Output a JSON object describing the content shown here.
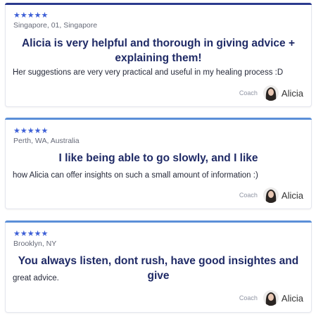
{
  "colors": {
    "accent_dark": "#2b3a8e",
    "accent_light": "#5b8fd8",
    "star": "#3d5fd6",
    "headline": "#1f2a66"
  },
  "reviews": [
    {
      "stars": "★★★★★",
      "location": "Singapore, 01, Singapore",
      "headline": "Alicia is very helpful and thorough in giving advice + explaining them!",
      "body": "Her suggestions are very very practical and useful in my healing process :D",
      "coach_label": "Coach",
      "coach_name": "Alicia"
    },
    {
      "stars": "★★★★★",
      "location": "Perth, WA, Australia",
      "headline": "I like being able to go slowly, and I like",
      "body": "how Alicia can offer insights on such a small amount of information :)",
      "coach_label": "Coach",
      "coach_name": "Alicia"
    },
    {
      "stars": "★★★★★",
      "location": "Brooklyn, NY",
      "headline": "You always listen, dont rush, have good insightes and give",
      "body": "great advice.",
      "coach_label": "Coach",
      "coach_name": "Alicia"
    }
  ]
}
